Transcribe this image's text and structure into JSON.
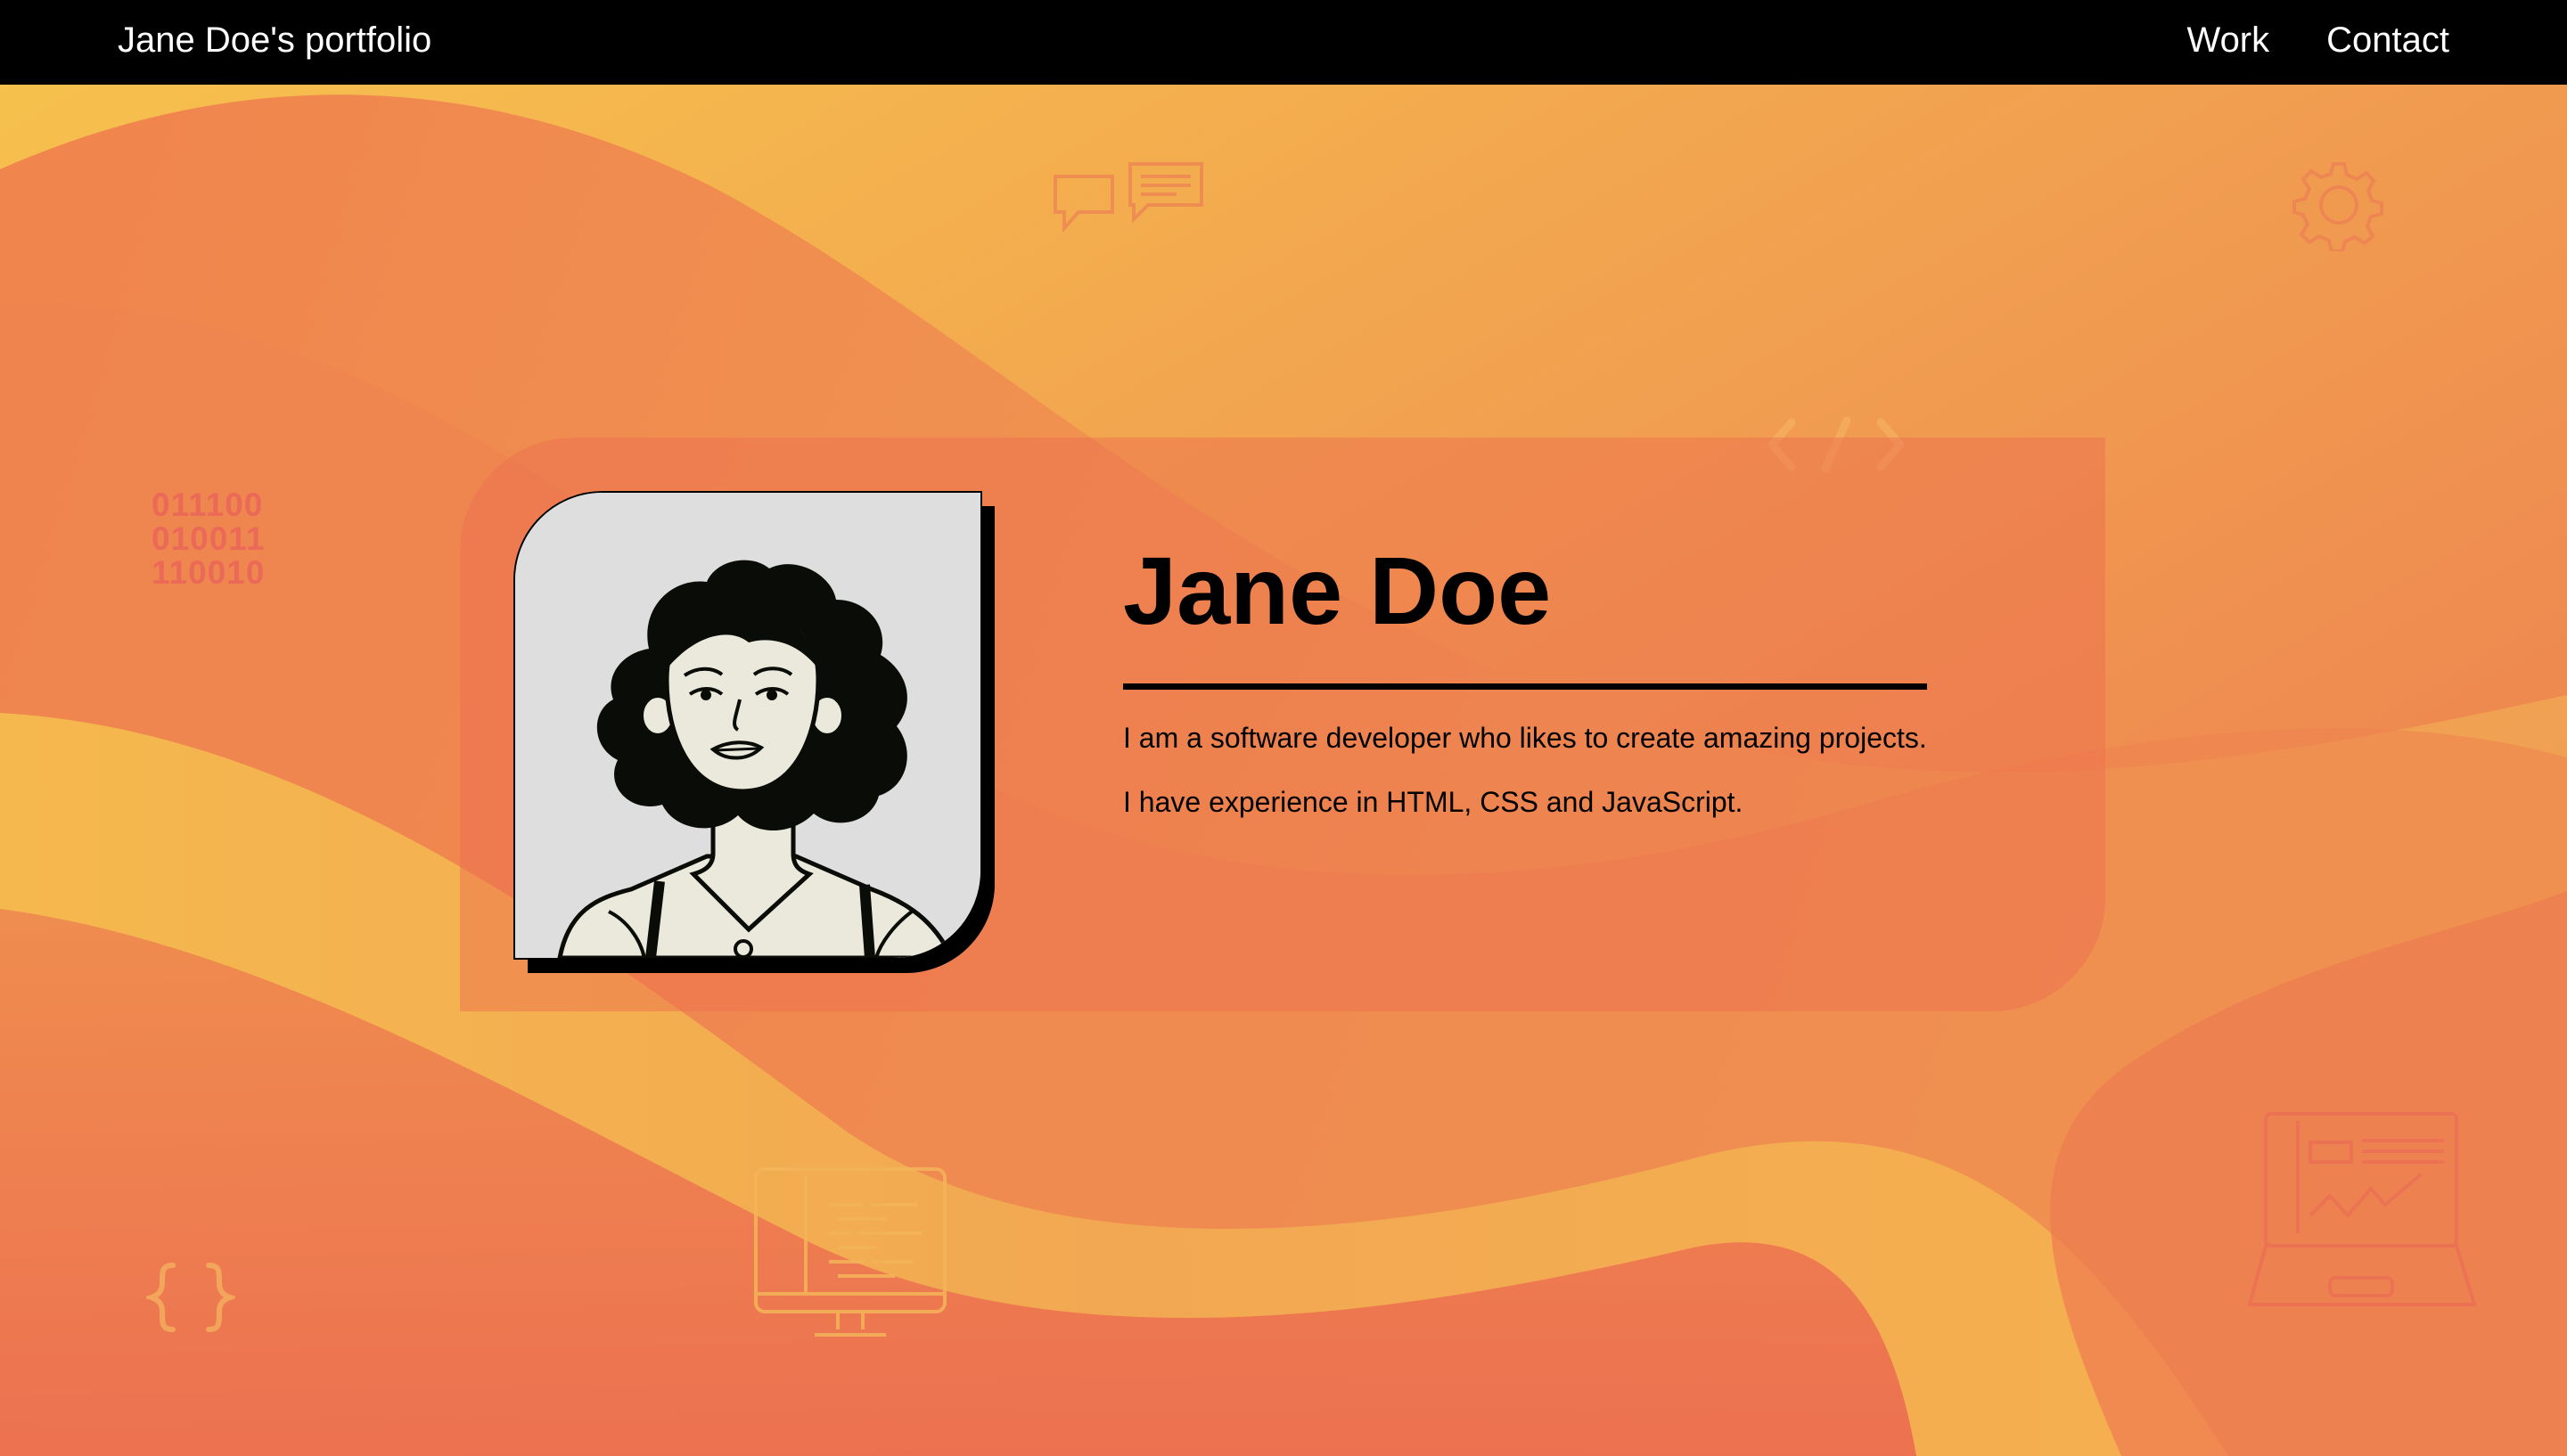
{
  "navbar": {
    "brand": "Jane Doe's portfolio",
    "links": [
      {
        "label": "Work"
      },
      {
        "label": "Contact"
      }
    ]
  },
  "hero": {
    "name": "Jane Doe",
    "bio_line_1": "I am a software developer who likes to create amazing projects.",
    "bio_line_2": "I have experience in HTML, CSS and JavaScript.",
    "avatar_icon": "woman-illustration"
  },
  "decorations": {
    "binary_rows": [
      "011100",
      "010011",
      "110010"
    ],
    "icons": [
      "chat-bubbles-icon",
      "gear-icon",
      "code-tag-icon",
      "binary-icon",
      "curly-braces-icon",
      "monitor-code-icon",
      "laptop-chart-icon"
    ]
  },
  "colors": {
    "navbar_bg": "#000000",
    "gradient_yellow": "#f7c04c",
    "gradient_orange": "#f08a4b",
    "card_tint": "#ec6e50",
    "text": "#000000"
  }
}
